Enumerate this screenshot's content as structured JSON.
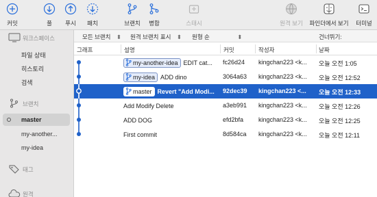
{
  "toolbar": {
    "commit": "커밋",
    "pull": "풀",
    "push": "푸시",
    "fetch": "패치",
    "branch": "브랜치",
    "merge": "병합",
    "stash": "스태시",
    "view_remote": "원격 보기",
    "show_in_finder": "파인더에서 보기",
    "terminal": "터미널"
  },
  "sidebar": {
    "workspace": "워크스페이스",
    "file_status": "파일 상태",
    "history": "히스토리",
    "search": "검색",
    "branches": "브랜치",
    "branch_items": [
      "master",
      "my-another...",
      "my-idea"
    ],
    "tags": "태그",
    "remotes": "원격"
  },
  "filter": {
    "all_branches": "모든 브랜치",
    "show_remote": "원격 브랜치 표시",
    "order": "원형 순",
    "skip": "건너뛰기:"
  },
  "columns": {
    "graph": "그래프",
    "description": "설명",
    "commit": "커밋",
    "author": "작성자",
    "date": "날짜"
  },
  "commits": [
    {
      "badge": "my-another-idea",
      "message": "EDIT cat...",
      "hash": "fc26d24",
      "author": "kingchan223 <k...",
      "date": "오늘 오전 1:05"
    },
    {
      "badge": "my-idea",
      "message": "ADD dino",
      "hash": "3064a63",
      "author": "kingchan223 <k...",
      "date": "오늘 오전 12:52"
    },
    {
      "badge": "master",
      "message": "Revert \"Add Modi...",
      "hash": "92dec39",
      "author": "kingchan223 <...",
      "date": "오늘 오전 12:33"
    },
    {
      "badge": "",
      "message": "Add Modify Delete",
      "hash": "a3eb991",
      "author": "kingchan223 <k...",
      "date": "오늘 오전 12:26"
    },
    {
      "badge": "",
      "message": "ADD DOG",
      "hash": "efd2bfa",
      "author": "kingchan223 <k...",
      "date": "오늘 오전 12:25"
    },
    {
      "badge": "",
      "message": "First commit",
      "hash": "8d584ca",
      "author": "kingchan223 <k...",
      "date": "오늘 오전 12:11"
    }
  ],
  "colors": {
    "accent": "#1f61c9",
    "graph_line": "#1f61c9",
    "sidebar_bg": "#e8e7e7",
    "toolbar_bg": "#ececec"
  }
}
